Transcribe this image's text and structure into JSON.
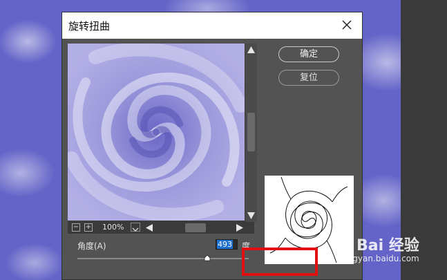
{
  "dialog": {
    "title": "旋转扭曲",
    "ok_label": "确定",
    "reset_label": "复位",
    "zoom": "100%",
    "angle_label": "角度(A)",
    "angle_value": "493",
    "unit": "度",
    "angle_slider_fraction": 0.76
  },
  "watermark": {
    "text": "Bai 经验",
    "url": "jingyan.baidu.com"
  },
  "colors": {
    "dialog_bg": "#535353",
    "highlight": "#e01010",
    "swirl": "#8a87d4",
    "selection": "#1d6fd0"
  },
  "icons": {
    "close": "close-icon",
    "zoom_out": "minus-icon",
    "zoom_in": "plus-icon",
    "dropdown": "chevron-down-icon",
    "scroll_up": "arrow-up-icon",
    "scroll_down": "arrow-down-icon",
    "scroll_left": "arrow-left-icon",
    "scroll_right": "arrow-right-icon"
  }
}
